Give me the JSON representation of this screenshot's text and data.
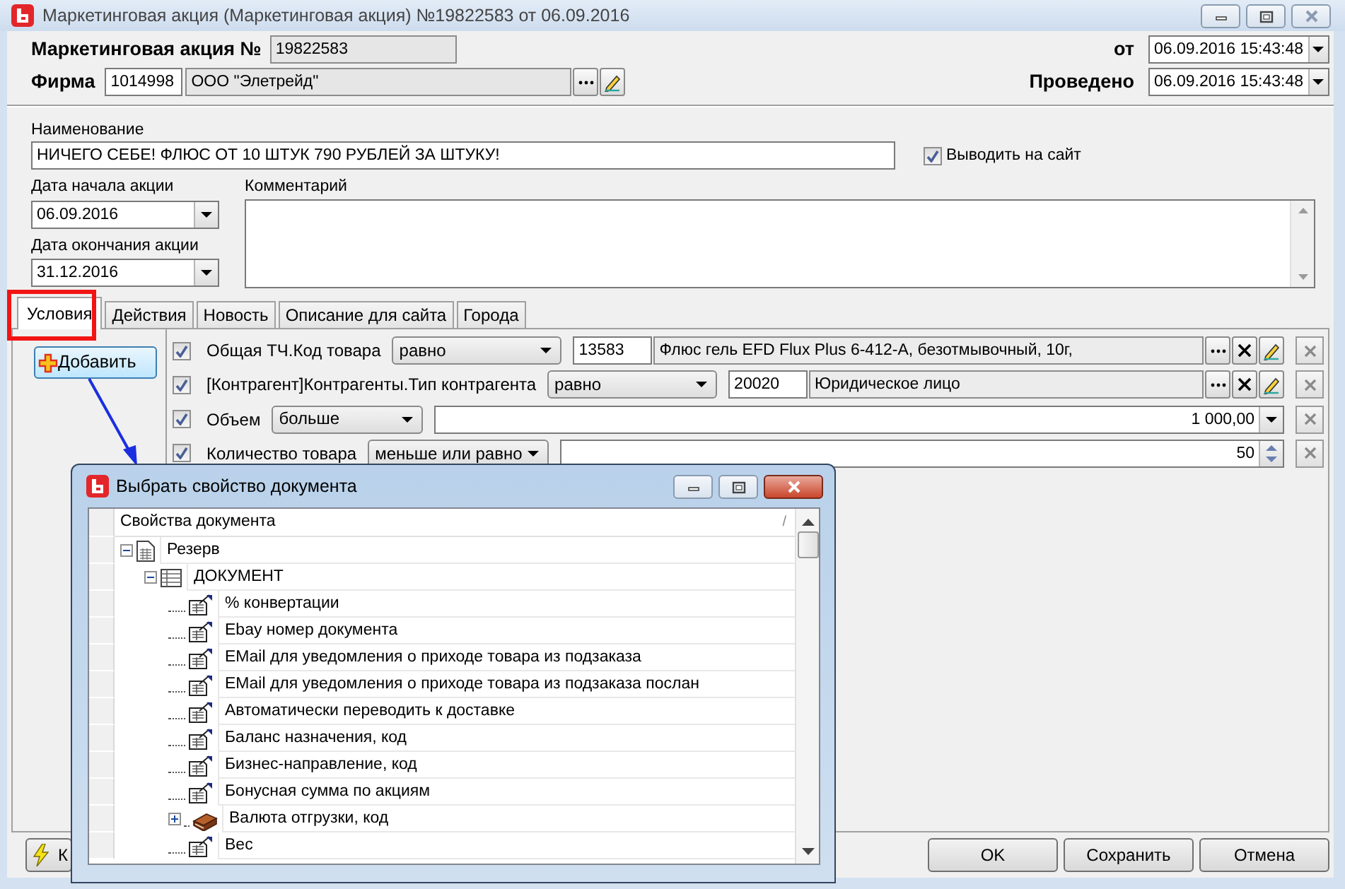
{
  "window": {
    "title": "Маркетинговая акция (Маркетинговая акция) №19822583 от 06.09.2016"
  },
  "header": {
    "number_label": "Маркетинговая акция №",
    "number": "19822583",
    "firm_label": "Фирма",
    "firm_code": "1014998",
    "firm_name": "ООО \"Элетрейд\"",
    "from_label": "от",
    "from_value": "06.09.2016 15:43:48",
    "posted_label": "Проведено",
    "posted_value": "06.09.2016 15:43:48"
  },
  "form": {
    "name_label": "Наименование",
    "name_value": "НИЧЕГО СЕБЕ! ФЛЮС ОТ 10 ШТУК 790 РУБЛЕЙ ЗА ШТУКУ!",
    "publish": {
      "label": "Выводить на сайт",
      "checked": true
    },
    "start_label": "Дата начала акции",
    "start_value": "06.09.2016",
    "end_label": "Дата окончания акции",
    "end_value": "31.12.2016",
    "comment_label": "Комментарий"
  },
  "tabs": [
    {
      "label": "Условия",
      "selected": true
    },
    {
      "label": "Действия",
      "selected": false
    },
    {
      "label": "Новость",
      "selected": false
    },
    {
      "label": "Описание для сайта",
      "selected": false
    },
    {
      "label": "Города",
      "selected": false
    }
  ],
  "add_button": "Добавить",
  "conditions": [
    {
      "kind": "reference",
      "checked": true,
      "field": "Общая ТЧ.Код товара",
      "operator": "равно",
      "code": "13583",
      "value": "Флюс гель EFD Flux Plus 6-412-A, безотмывочный, 10г,"
    },
    {
      "kind": "reference",
      "checked": true,
      "field": "[Контрагент]Контрагенты.Тип контрагента",
      "operator": "равно",
      "code": "20020",
      "value": "Юридическое лицо"
    },
    {
      "kind": "number",
      "checked": true,
      "field": "Объем",
      "operator": "больше",
      "value": "1 000,00"
    },
    {
      "kind": "spin",
      "checked": true,
      "field": "Количество товара",
      "operator": "меньше или равно",
      "value": "50"
    }
  ],
  "footer": {
    "partial_button": "К",
    "buttons": [
      "OK",
      "Сохранить",
      "Отмена"
    ]
  },
  "dialog": {
    "title": "Выбрать свойство документа",
    "column": "Свойства документа",
    "sort_mark": "/",
    "tree": [
      {
        "label": "Резерв",
        "kind": "document",
        "expanded": true,
        "children": [
          {
            "label": "ДОКУМЕНТ",
            "kind": "table",
            "expanded": true,
            "children": [
              {
                "label": "% конвертации",
                "kind": "property"
              },
              {
                "label": "Ebay номер документа",
                "kind": "property"
              },
              {
                "label": "EMail для уведомления о приходе товара из подзаказа",
                "kind": "property"
              },
              {
                "label": "EMail для уведомления о приходе товара из подзаказа послан",
                "kind": "property"
              },
              {
                "label": "Автоматически переводить к доставке",
                "kind": "property"
              },
              {
                "label": "Баланс назначения, код",
                "kind": "property"
              },
              {
                "label": "Бизнес-направление, код",
                "kind": "property"
              },
              {
                "label": "Бонусная сумма по акциям",
                "kind": "property"
              },
              {
                "label": "Валюта отгрузки, код",
                "kind": "reference",
                "expanded": false
              },
              {
                "label": "Вес",
                "kind": "property"
              }
            ]
          }
        ]
      }
    ]
  }
}
